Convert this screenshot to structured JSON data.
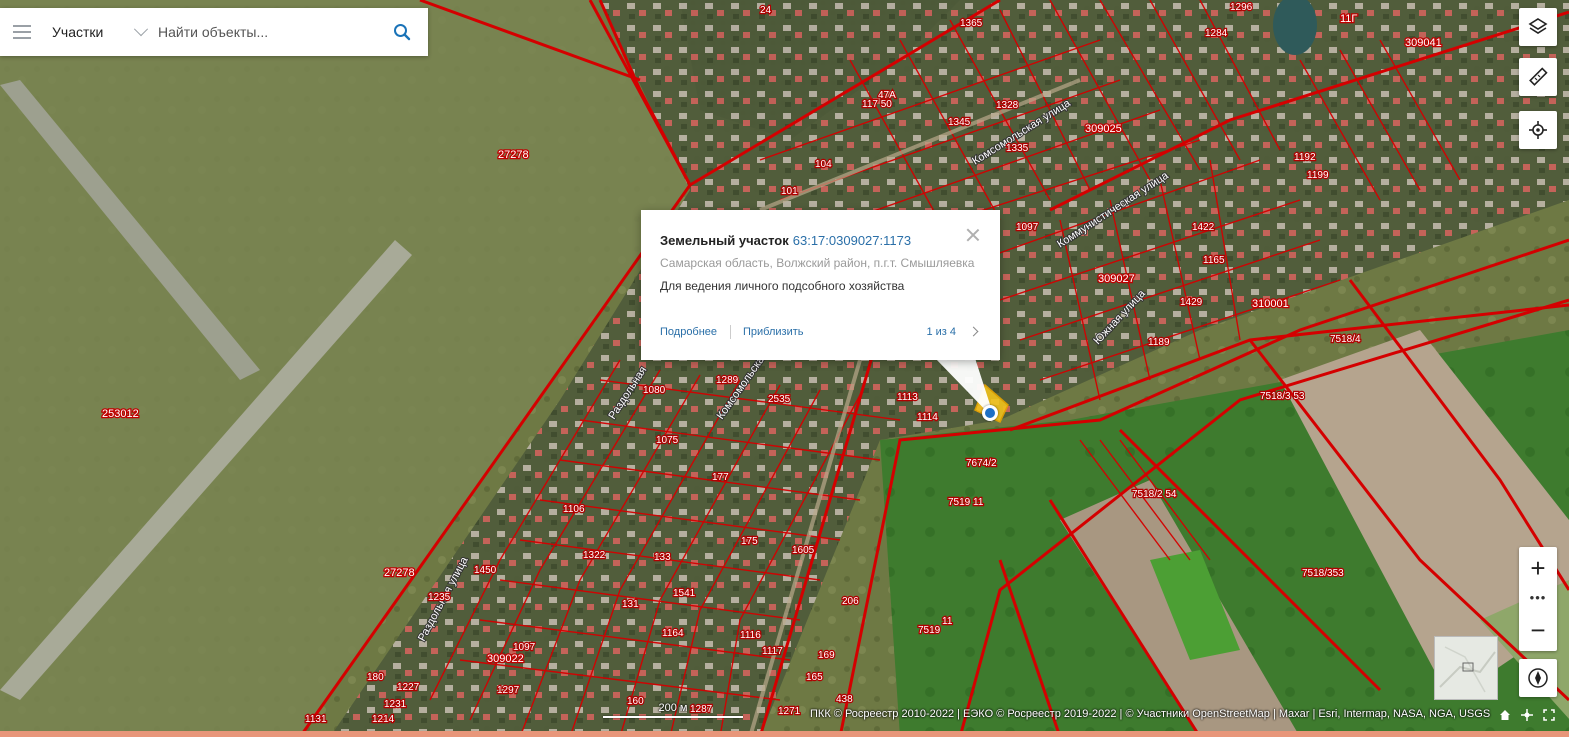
{
  "search": {
    "category": "Участки",
    "placeholder": "Найти объекты..."
  },
  "popup": {
    "type_label": "Земельный участок",
    "cadastral_number": "63:17:0309027:1173",
    "address": "Самарская область, Волжский район, п.г.т. Смышляевка",
    "purpose": "Для ведения личного подсобного хозяйства",
    "more_label": "Подробнее",
    "zoom_label": "Приблизить",
    "pager": "1 из 4"
  },
  "map": {
    "quarters": [
      "309041",
      "309025",
      "309027",
      "310001",
      "309022",
      "253012",
      "27278",
      "27278",
      "11Г"
    ],
    "streets": [
      "Комсомольская улица",
      "Коммунистическая улица",
      "Южная улица",
      "Комсомольская",
      "Раздольная",
      "Раздольная улица"
    ],
    "parcels": [
      "24",
      "1365",
      "47А",
      "117 50",
      "104",
      "101",
      "7518/4",
      "7518/3 53",
      "7674/2",
      "7519 11",
      "7518/2 54",
      "7518/353",
      "7519",
      "11",
      "1080",
      "1289",
      "2535",
      "1075",
      "1113",
      "1114",
      "1106",
      "1322",
      "1450",
      "1541",
      "1164",
      "1097",
      "1297",
      "1227",
      "1231",
      "1214",
      "1131",
      "1605",
      "206",
      "1116",
      "1117",
      "1271",
      "438",
      "1287",
      "160",
      "1422",
      "1165",
      "1429",
      "1189",
      "1192",
      "1199",
      "1345",
      "1328",
      "1335",
      "1284",
      "1296",
      "165",
      "169",
      "131",
      "133",
      "175",
      "177",
      "180",
      "1235",
      "1097"
    ],
    "accent_color": "#d40000"
  },
  "zoom": {
    "plus": "+",
    "dots": "•••",
    "minus": "−"
  },
  "scale_label": "200 м",
  "attribution": "ПКК © Росреестр 2010-2022 | ЕЭКО © Росреестр 2019-2022 | © Участники OpenStreetMap | Maxar | Esri, Intermap, NASA, NGA, USGS",
  "icons": {
    "layers": "layers-icon",
    "ruler": "ruler-icon",
    "locate": "locate-icon",
    "compass": "compass-icon",
    "search": "search-icon",
    "menu": "menu-icon",
    "close": "close-icon",
    "home": "home-icon",
    "target": "target-icon",
    "fullscreen": "fullscreen-icon"
  }
}
